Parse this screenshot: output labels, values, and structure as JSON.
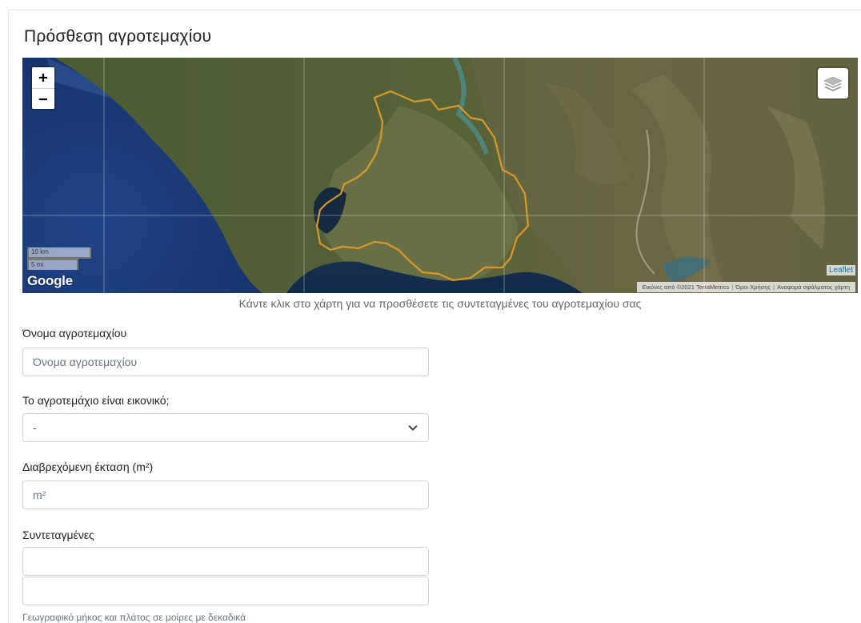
{
  "page": {
    "title": "Πρόσθεση αγροτεμαχίου"
  },
  "map": {
    "zoom_in_label": "+",
    "zoom_out_label": "−",
    "layers_icon": "layers-icon",
    "scale_km": "10 km",
    "scale_mi": "5 mi",
    "google_logo_text": "Google",
    "leaflet_link": "Leaflet",
    "attribution": {
      "imagery": "Εικόνες από ©2021 TerraMetrics",
      "terms": "Όροι Χρήσης",
      "report": "Αναφορά σφάλματος χάρτη"
    },
    "hint": "Κάντε κλικ στο χάρτη για να προσθέσετε τις συντεταγμένες του αγροτεμαχίου σας",
    "colors": {
      "boundary": "#d9982a",
      "sea": "#1e3f7a"
    }
  },
  "form": {
    "name": {
      "label": "Όνομα αγροτεμαχίου",
      "placeholder": "Όνομα αγροτεμαχίου",
      "value": ""
    },
    "virtual": {
      "label": "Το αγροτεμάχιο είναι εικονικό;",
      "selected": "-"
    },
    "area": {
      "label": "Διαβρεχόμενη έκταση (m²)",
      "placeholder": "m²",
      "value": ""
    },
    "coordinates": {
      "label": "Συντεταγμένες",
      "longitude_value": "",
      "latitude_value": "",
      "help": "Γεωγραφικό μήκος και πλάτος σε μοίρες με δεκαδικά"
    }
  }
}
